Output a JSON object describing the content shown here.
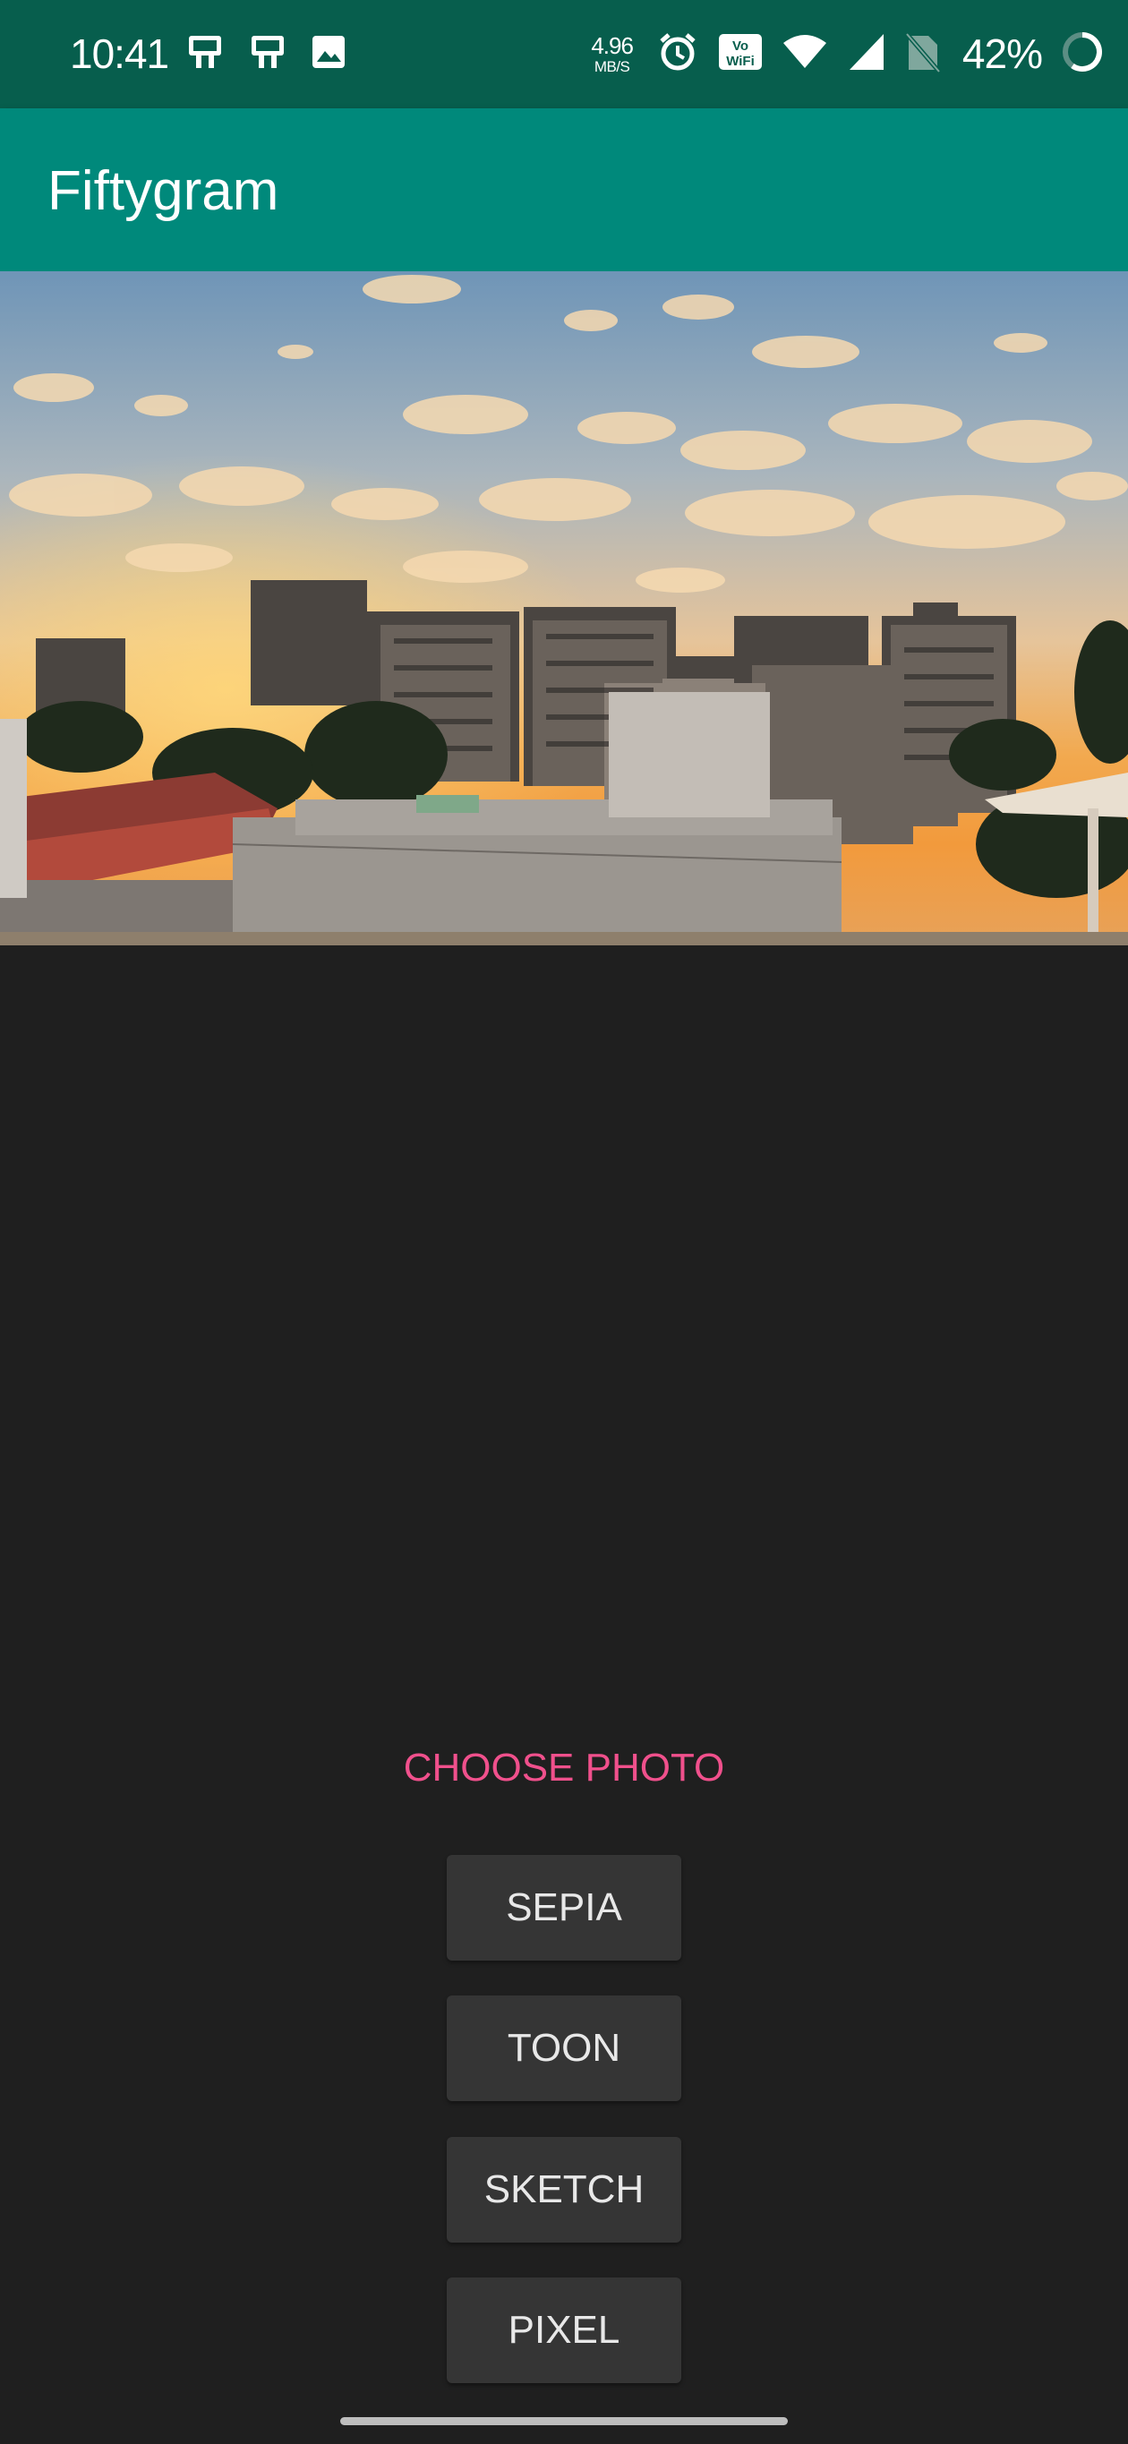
{
  "status_bar": {
    "time": "10:41",
    "net_speed_value": "4.96",
    "net_speed_unit": "MB/S",
    "battery_percent": "42%",
    "left_icons": [
      "device-icon",
      "device-icon",
      "image-icon"
    ],
    "right_icons": [
      "alarm-icon",
      "vowifi-icon",
      "wifi-icon",
      "cell-signal-icon",
      "no-sim-icon",
      "battery-ring-icon"
    ]
  },
  "app_bar": {
    "title": "Fiftygram"
  },
  "photo": {
    "subject": "sunset-city-skyline"
  },
  "actions": {
    "choose_photo": "CHOOSE PHOTO"
  },
  "filters": {
    "sepia": "SEPIA",
    "toon": "TOON",
    "sketch": "SKETCH",
    "pixel": "PIXEL"
  },
  "colors": {
    "status_bar": "#075e4d",
    "app_bar": "#00897b",
    "background": "#1f1f1f",
    "accent": "#f0508c",
    "button": "#353535"
  }
}
